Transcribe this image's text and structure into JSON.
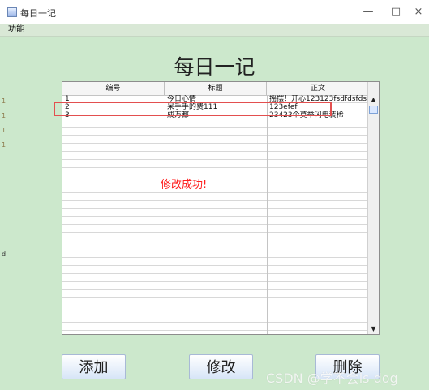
{
  "window": {
    "title": "每日一记",
    "controls": [
      "—",
      "□",
      "×"
    ]
  },
  "menu": {
    "item": "功能"
  },
  "page": {
    "heading": "每日一记",
    "status": "修改成功!"
  },
  "table": {
    "headers": [
      "编号",
      "标题",
      "正文"
    ],
    "rows": [
      [
        "1",
        "今日心情",
        "摇摆！开心123123fsdfdsfds"
      ],
      [
        "2",
        "呆手手的费111",
        "123efef"
      ],
      [
        "3",
        "成万都",
        "23423个莫举闪电装稀"
      ]
    ]
  },
  "buttons": {
    "add": "添加",
    "edit": "修改",
    "delete": "删除"
  },
  "watermark": "CSDN @学不会is dog",
  "edge_marks": [
    "1",
    "1",
    "1",
    "1",
    "d"
  ],
  "colors": {
    "background": "#cce8cc",
    "highlight_border": "#e34f4f",
    "status_text": "#ff1e1e"
  }
}
